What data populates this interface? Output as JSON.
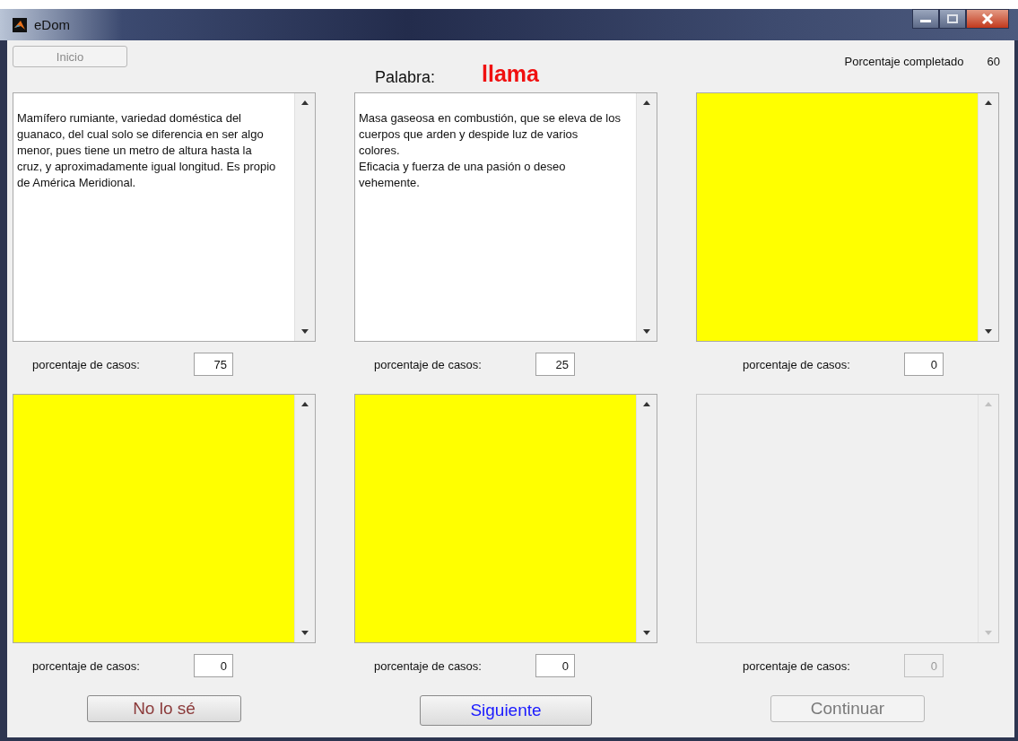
{
  "window": {
    "title": "eDom"
  },
  "start_button": {
    "label": "Inicio",
    "disabled": true
  },
  "word": {
    "label": "Palabra:",
    "value": "llama"
  },
  "progress": {
    "label": "Porcentaje completado",
    "value": "60"
  },
  "panels": [
    {
      "kind": "text",
      "text": "Mamífero rumiante, variedad doméstica del guanaco, del cual solo se diferencia en ser algo menor, pues tiene un metro de altura hasta la cruz, y aproximadamente igual longitud. Es propio de América Meridional.",
      "label": "porcentaje de casos:",
      "value": "75",
      "disabled": false
    },
    {
      "kind": "text",
      "text": "Masa gaseosa en combustión, que se eleva de los cuerpos que arden y despide luz de varios colores.\nEficacia y fuerza de una pasión o deseo vehemente.",
      "label": "porcentaje de casos:",
      "value": "25",
      "disabled": false
    },
    {
      "kind": "highlight",
      "label": "porcentaje de casos:",
      "value": "0",
      "disabled": false
    },
    {
      "kind": "highlight",
      "label": "porcentaje de casos:",
      "value": "0",
      "disabled": false
    },
    {
      "kind": "highlight",
      "label": "porcentaje de casos:",
      "value": "0",
      "disabled": false
    },
    {
      "kind": "empty",
      "label": "porcentaje de casos:",
      "value": "0",
      "disabled": true
    }
  ],
  "buttons": [
    {
      "label": "No lo sé",
      "color": "#8b3a3a",
      "disabled": false
    },
    {
      "label": "Siguiente",
      "color": "#1a1aff",
      "disabled": false
    },
    {
      "label": "Continuar",
      "color": "#7a7a7a",
      "disabled": true
    }
  ]
}
